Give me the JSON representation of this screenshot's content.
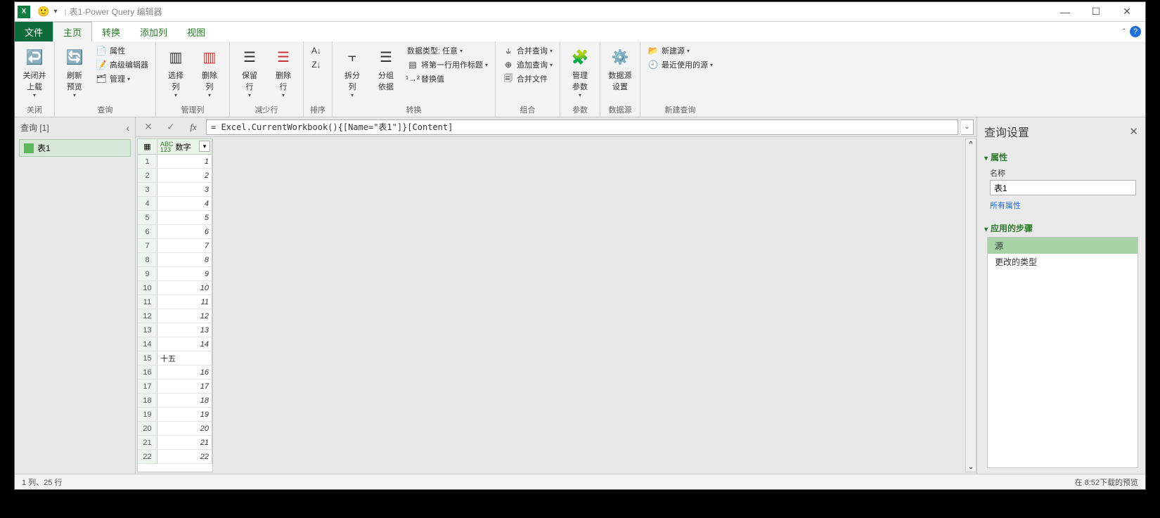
{
  "window": {
    "title_query": "表1",
    "title_app": "Power Query 编辑器",
    "separator": " - "
  },
  "tabs": {
    "file": "文件",
    "home": "主页",
    "transform": "转换",
    "addcol": "添加列",
    "view": "视图"
  },
  "ribbon": {
    "close": {
      "close_load": "关闭并\n上载",
      "group": "关闭"
    },
    "query": {
      "refresh": "刷新\n预览",
      "properties": "属性",
      "adv_editor": "高级编辑器",
      "manage": "管理",
      "group": "查询"
    },
    "cols": {
      "choose": "选择\n列",
      "remove": "删除\n列",
      "group": "管理列"
    },
    "rows": {
      "keep": "保留\n行",
      "remove": "删除\n行",
      "group": "减少行"
    },
    "sort": {
      "group": "排序"
    },
    "transform": {
      "split": "拆分\n列",
      "groupby": "分组\n依据",
      "datatype": "数据类型: 任意",
      "first_row": "将第一行用作标题",
      "replace": "替换值",
      "group": "转换"
    },
    "combine": {
      "merge": "合并查询",
      "append": "追加查询",
      "combine_files": "合并文件",
      "group": "组合"
    },
    "params": {
      "manage": "管理\n参数",
      "group": "参数"
    },
    "datasource": {
      "settings": "数据源\n设置",
      "group": "数据源"
    },
    "newquery": {
      "new_source": "新建源",
      "recent": "最近使用的源",
      "group": "新建查询"
    }
  },
  "queries_pane": {
    "title": "查询 [1]",
    "items": [
      "表1"
    ]
  },
  "formula": "= Excel.CurrentWorkbook(){[Name=\"表1\"]}[Content]",
  "table": {
    "col_header": "数字",
    "type_hint": "ABC\n123",
    "rows": [
      {
        "n": 1,
        "v": "1",
        "kind": "num"
      },
      {
        "n": 2,
        "v": "2",
        "kind": "num"
      },
      {
        "n": 3,
        "v": "3",
        "kind": "num"
      },
      {
        "n": 4,
        "v": "4",
        "kind": "num"
      },
      {
        "n": 5,
        "v": "5",
        "kind": "num"
      },
      {
        "n": 6,
        "v": "6",
        "kind": "num"
      },
      {
        "n": 7,
        "v": "7",
        "kind": "num"
      },
      {
        "n": 8,
        "v": "8",
        "kind": "num"
      },
      {
        "n": 9,
        "v": "9",
        "kind": "num"
      },
      {
        "n": 10,
        "v": "10",
        "kind": "num"
      },
      {
        "n": 11,
        "v": "11",
        "kind": "num"
      },
      {
        "n": 12,
        "v": "12",
        "kind": "num"
      },
      {
        "n": 13,
        "v": "13",
        "kind": "num"
      },
      {
        "n": 14,
        "v": "14",
        "kind": "num"
      },
      {
        "n": 15,
        "v": "十五",
        "kind": "txt"
      },
      {
        "n": 16,
        "v": "16",
        "kind": "num"
      },
      {
        "n": 17,
        "v": "17",
        "kind": "num"
      },
      {
        "n": 18,
        "v": "18",
        "kind": "num"
      },
      {
        "n": 19,
        "v": "19",
        "kind": "num"
      },
      {
        "n": 20,
        "v": "20",
        "kind": "num"
      },
      {
        "n": 21,
        "v": "21",
        "kind": "num"
      },
      {
        "n": 22,
        "v": "22",
        "kind": "num"
      }
    ]
  },
  "settings": {
    "title": "查询设置",
    "properties": "属性",
    "name_label": "名称",
    "name_value": "表1",
    "all_props": "所有属性",
    "applied_steps": "应用的步骤",
    "steps": [
      "源",
      "更改的类型"
    ],
    "selected_step": 0
  },
  "status": {
    "left": "1 列、25 行",
    "right": "在 8:52下载的预览"
  }
}
